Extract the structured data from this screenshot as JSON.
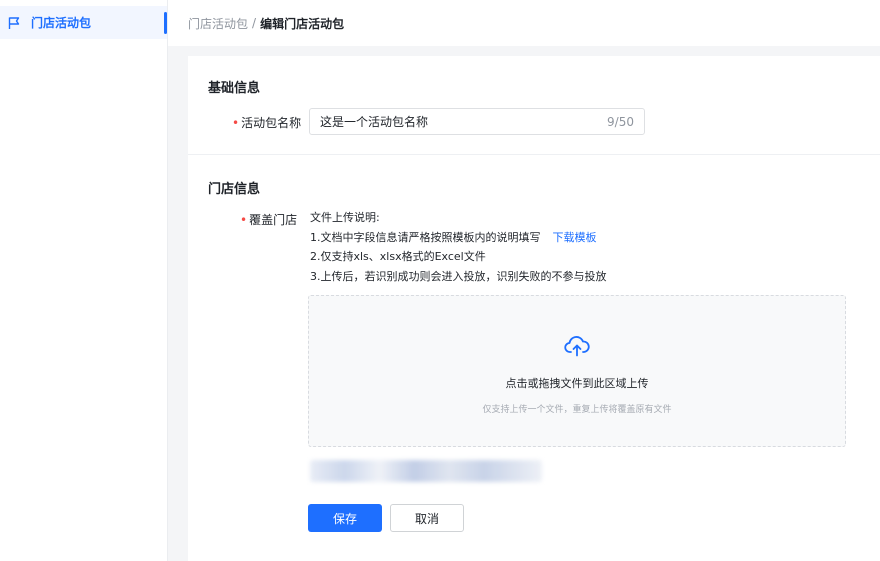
{
  "sidebar": {
    "items": [
      {
        "label": "门店活动包",
        "icon": "flag-icon",
        "active": true
      }
    ]
  },
  "breadcrumb": {
    "parent": "门店活动包",
    "separator": "/",
    "current": "编辑门店活动包"
  },
  "basic_section": {
    "title": "基础信息",
    "name_field": {
      "required_mark": "•",
      "label": "活动包名称",
      "value": "这是一个活动包名称",
      "count": "9/50"
    }
  },
  "store_section": {
    "title": "门店信息",
    "coverage_field": {
      "required_mark": "•",
      "label": "覆盖门店"
    },
    "description": {
      "heading": "文件上传说明:",
      "line1": "1.文档中字段信息请严格按照模板内的说明填写",
      "download_link": "下载模板",
      "line2": "2.仅支持xls、xlsx格式的Excel文件",
      "line3": "3.上传后，若识别成功则会进入投放，识别失败的不参与投放"
    },
    "upload": {
      "icon": "cloud-upload-icon",
      "main_text": "点击或拖拽文件到此区域上传",
      "hint_text": "仅支持上传一个文件，重复上传将覆盖原有文件"
    }
  },
  "actions": {
    "save_label": "保存",
    "cancel_label": "取消"
  },
  "colors": {
    "accent": "#1e6fff",
    "required": "#f54a45"
  }
}
